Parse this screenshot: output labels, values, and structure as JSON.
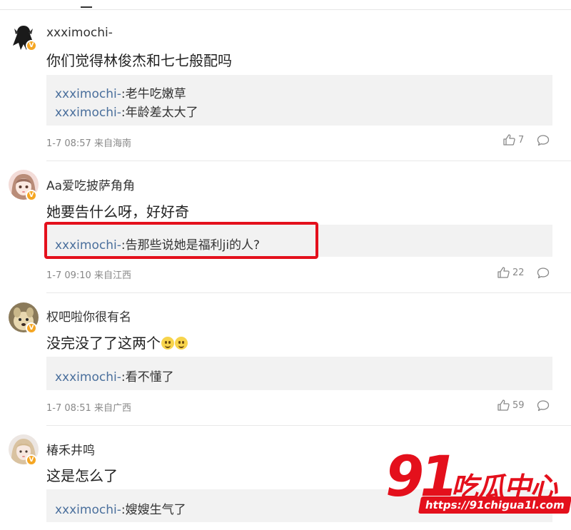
{
  "comments": [
    {
      "username": "xxximochi-",
      "text": "你们觉得林俊杰和七七般配吗",
      "replies": [
        {
          "user": "xxximochi-",
          "sep": ":",
          "text": "老牛吃嫩草"
        },
        {
          "user": "xxximochi-",
          "sep": ":",
          "text": "年龄差太大了"
        }
      ],
      "time": "1-7 08:57 来自海南",
      "likes": "7",
      "avatar": "dark-figure-avatar",
      "badge": "V"
    },
    {
      "username": "Aa爱吃披萨角角",
      "text": "她要告什么呀，好好奇",
      "replies": [
        {
          "user": "xxximochi-",
          "sep": ":",
          "text": "告那些说她是福利ji的人?"
        }
      ],
      "time": "1-7 09:10 来自江西",
      "likes": "22",
      "avatar": "anime-girl-avatar",
      "badge": "V"
    },
    {
      "username": "权吧啦你很有名",
      "text": "没完没了了这两个",
      "emoji": [
        "smile-emoji",
        "smile-emoji"
      ],
      "replies": [
        {
          "user": "xxximochi-",
          "sep": ":",
          "text": "看不懂了"
        }
      ],
      "time": "1-7 08:51 来自广西",
      "likes": "59",
      "avatar": "dog-photo-avatar",
      "badge": "V"
    },
    {
      "username": "椿禾井鸣",
      "text": "这是怎么了",
      "replies": [
        {
          "user": "xxximochi-",
          "sep": ":",
          "text": "嫂嫂生气了"
        }
      ],
      "avatar": "blonde-girl-avatar",
      "badge": "V"
    }
  ],
  "watermark": {
    "number": "91",
    "name": "吃瓜中心",
    "url": "https://91chigua1l.com"
  },
  "colors": {
    "reply_user": "#4a6f9c",
    "highlight": "#e4101c",
    "badge": "#f5a623"
  }
}
